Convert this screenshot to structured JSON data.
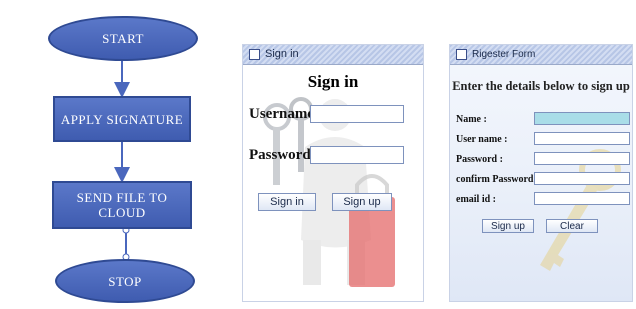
{
  "flowchart": {
    "start": "START",
    "apply": "APPLY SIGNATURE",
    "send": "SEND FILE TO CLOUD",
    "stop": "STOP"
  },
  "signin_window": {
    "title": "Sign in",
    "heading": "Sign in",
    "username_label": "Username:",
    "password_label": "Password:",
    "username_value": "",
    "password_value": "",
    "signin_button": "Sign in",
    "signup_button": "Sign up"
  },
  "register_window": {
    "title": "Rigester Form",
    "heading": "Enter the details below to sign up",
    "name_label": "Name :",
    "username_label": "User name :",
    "password_label": "Password :",
    "confirm_label": "confirm Password :",
    "email_label": "email id :",
    "signup_button": "Sign up",
    "clear_button": "Clear"
  },
  "colors": {
    "flow_node": "#4a67bd",
    "arrow": "#4a67bd",
    "titlebar": "#c3d0ec",
    "focused_field": "#a9dde8"
  },
  "icons": [
    "window-icon",
    "keys-illustration",
    "figure-with-lock-illustration"
  ]
}
